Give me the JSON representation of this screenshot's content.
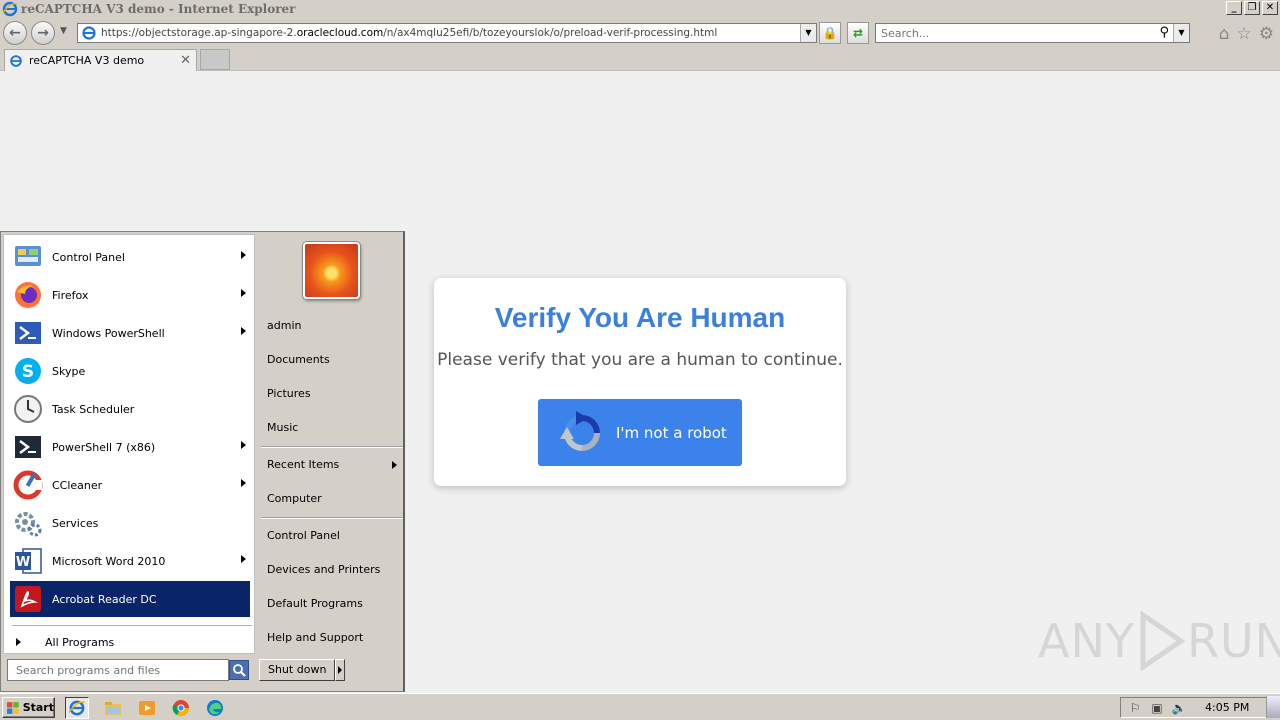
{
  "window": {
    "title": "reCAPTCHA V3 demo - Internet Explorer",
    "minimize": "_",
    "restore": "❐",
    "close": "✕"
  },
  "toolbar": {
    "url_prefix": "https://objectstorage.ap-singapore-2.",
    "url_domain": "oraclecloud.com",
    "url_path": "/n/ax4mqlu25efi/b/tozeyourslok/o/preload-verif-processing.html",
    "search_placeholder": "Search..."
  },
  "tabs": [
    {
      "label": "reCAPTCHA V3 demo"
    }
  ],
  "page": {
    "heading": "Verify You Are Human",
    "message": "Please verify that you are a human to continue.",
    "button_label": "I'm not a robot",
    "accent": "#3b82ea"
  },
  "watermark": {
    "text_left": "ANY",
    "text_right": "RUN"
  },
  "start_menu": {
    "pinned": [
      {
        "label": "Control Panel",
        "icon": "control-panel-icon",
        "submenu": true
      },
      {
        "label": "Firefox",
        "icon": "firefox-icon",
        "submenu": true
      },
      {
        "label": "Windows PowerShell",
        "icon": "powershell-icon",
        "submenu": true
      },
      {
        "label": "Skype",
        "icon": "skype-icon",
        "submenu": false
      },
      {
        "label": "Task Scheduler",
        "icon": "task-scheduler-icon",
        "submenu": false
      },
      {
        "label": "PowerShell 7 (x86)",
        "icon": "powershell7-icon",
        "submenu": true
      },
      {
        "label": "CCleaner",
        "icon": "ccleaner-icon",
        "submenu": true
      },
      {
        "label": "Services",
        "icon": "services-icon",
        "submenu": false
      },
      {
        "label": "Microsoft Word 2010",
        "icon": "word-icon",
        "submenu": true
      },
      {
        "label": "Acrobat Reader DC",
        "icon": "acrobat-icon",
        "submenu": false,
        "selected": true
      }
    ],
    "all_programs": "All Programs",
    "search_placeholder": "Search programs and files",
    "right_items": [
      {
        "label": "admin"
      },
      {
        "label": "Documents"
      },
      {
        "label": "Pictures"
      },
      {
        "label": "Music"
      },
      {
        "label": "Recent Items",
        "submenu": true
      },
      {
        "label": "Computer"
      },
      {
        "label": "Control Panel"
      },
      {
        "label": "Devices and Printers"
      },
      {
        "label": "Default Programs"
      },
      {
        "label": "Help and Support"
      }
    ],
    "shutdown": "Shut down"
  },
  "taskbar": {
    "start_label": "Start",
    "clock": "4:05 PM"
  }
}
